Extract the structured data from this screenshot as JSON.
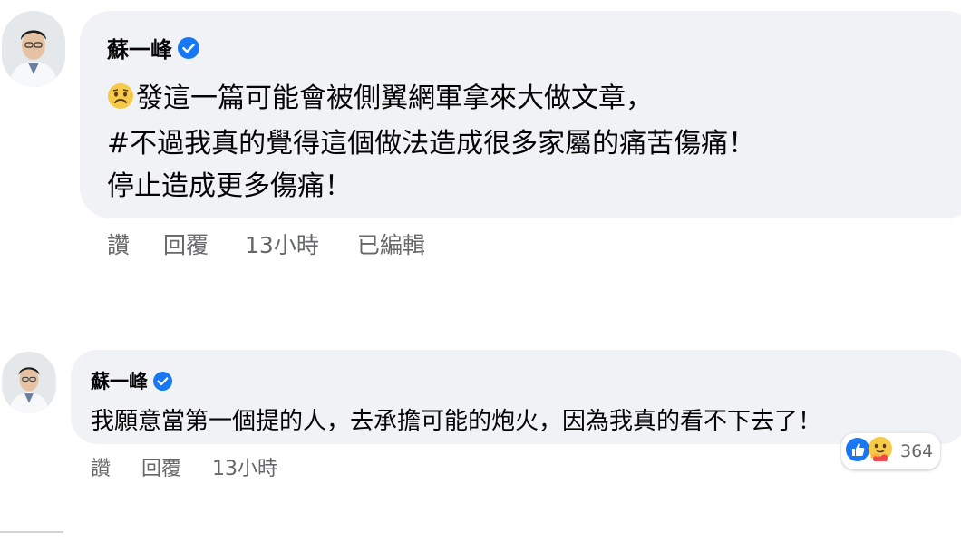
{
  "comments": [
    {
      "author": "蘇一峰",
      "lines": [
        "發這一篇可能會被側翼網軍拿來大做文章，",
        "#不過我真的覺得這個做法造成很多家屬的痛苦傷痛！",
        "停止造成更多傷痛！"
      ],
      "actions": {
        "like": "讚",
        "reply": "回覆",
        "time": "13小時",
        "edited": "已編輯"
      }
    },
    {
      "author": "蘇一峰",
      "lines": [
        "我願意當第一個提的人，去承擔可能的炮火，因為我真的看不下去了！"
      ],
      "actions": {
        "like": "讚",
        "reply": "回覆",
        "time": "13小時"
      },
      "reactions": {
        "count": "364",
        "icons": [
          "like-icon",
          "care-icon"
        ]
      }
    }
  ],
  "colors": {
    "bubble": "#f0f2f5",
    "verified": "#1877f2",
    "meta": "#65676b",
    "text": "#050505"
  }
}
